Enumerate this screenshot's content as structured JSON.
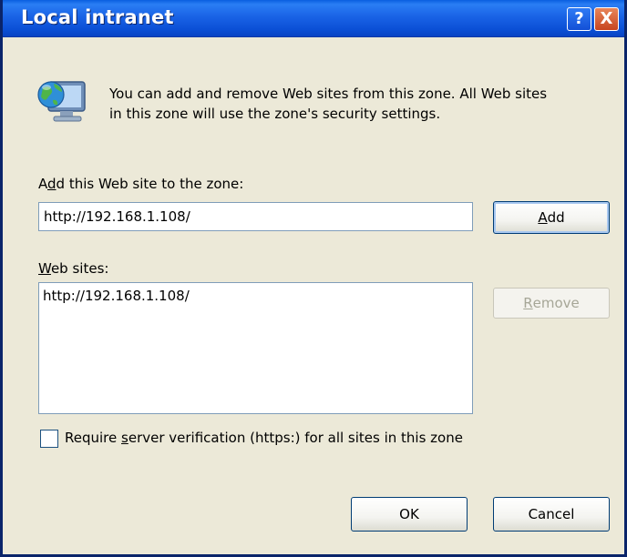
{
  "window": {
    "title": "Local intranet",
    "help_glyph": "?",
    "close_glyph": "X"
  },
  "info": {
    "icon": "local-intranet-monitor-globe-icon",
    "line1": "You can add and remove Web sites from this zone. All Web sites",
    "line2": "in this zone will use the zone's security settings."
  },
  "add_section": {
    "label_pre": "A",
    "label_mnemonic": "d",
    "label_post": "d this Web site to the zone:",
    "input_value": "http://192.168.1.108/",
    "add_button_mnemonic": "A",
    "add_button_rest": "dd"
  },
  "sites_section": {
    "label_mnemonic": "W",
    "label_post": "eb sites:",
    "items": [
      "http://192.168.1.108/"
    ],
    "remove_button_mnemonic": "R",
    "remove_button_rest": "emove"
  },
  "checkbox": {
    "checked": false,
    "label_pre": "Require ",
    "label_mnemonic": "s",
    "label_post": "erver verification (https:) for all sites in this zone"
  },
  "footer": {
    "ok_label": "OK",
    "cancel_label": "Cancel"
  },
  "colors": {
    "titlebar": "#0B50D6",
    "dialog_bg": "#ECE9D8",
    "control_border": "#7F9DB9",
    "disabled_text": "#A6A697"
  }
}
